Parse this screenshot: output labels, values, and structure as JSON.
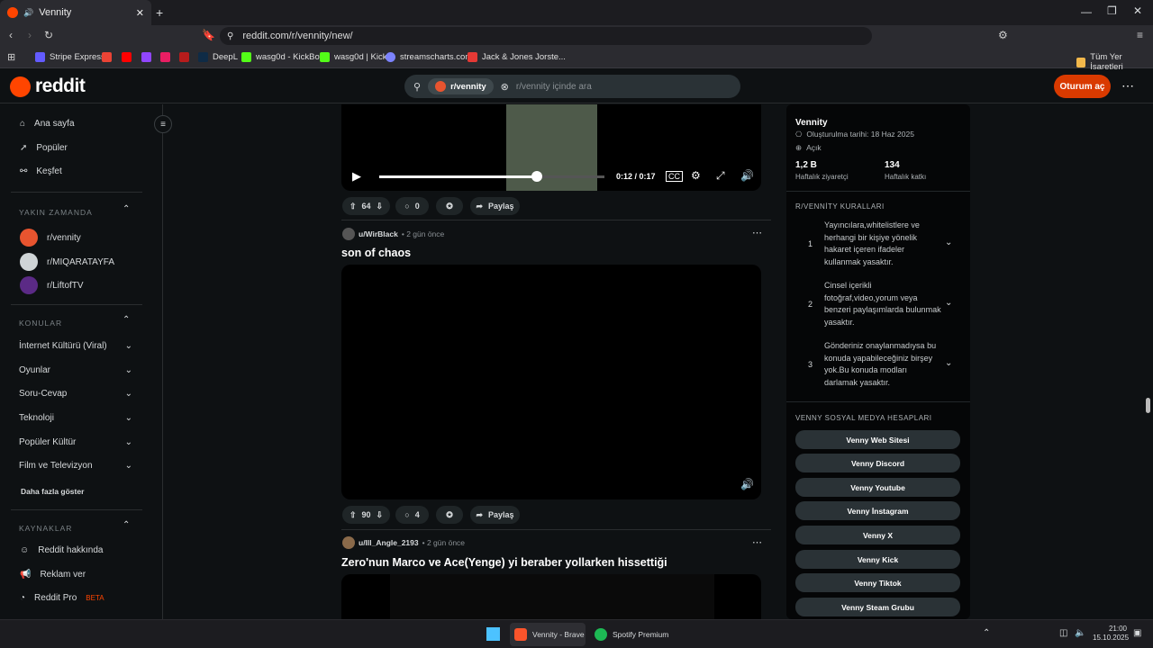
{
  "browser": {
    "tab_title": "Vennity",
    "url": "reddit.com/r/vennity/new/",
    "bookmarks": [
      "Stripe Express",
      "DeepL",
      "wasg0d - KickBot",
      "wasg0d | Kick",
      "streamscharts.com",
      "Jack & Jones Jorste..."
    ],
    "all_bookmarks": "Tüm Yer İşaretleri"
  },
  "header": {
    "logo": "reddit",
    "search_chip": "r/vennity",
    "search_placeholder": "r/vennity içinde ara",
    "login": "Oturum aç"
  },
  "sidebar": {
    "nav": [
      "Ana sayfa",
      "Popüler",
      "Keşfet"
    ],
    "recent_title": "YAKIN ZAMANDA",
    "recent": [
      "r/vennity",
      "r/MIQARATAYFA",
      "r/LiftofTV"
    ],
    "topics_title": "KONULAR",
    "topics": [
      "İnternet Kültürü (Viral)",
      "Oyunlar",
      "Soru-Cevap",
      "Teknoloji",
      "Popüler Kültür",
      "Film ve Televizyon"
    ],
    "more": "Daha fazla göster",
    "resources_title": "KAYNAKLAR",
    "resources": [
      "Reddit hakkında",
      "Reklam ver",
      "Reddit Pro"
    ],
    "beta": "BETA"
  },
  "feed": {
    "video1": {
      "time": "0:12 / 0:17",
      "progress": 0.7,
      "votes": "64",
      "comments": "0",
      "share": "Paylaş"
    },
    "post2": {
      "user": "u/WirBlack",
      "age": "• 2 gün önce",
      "title": "son of chaos",
      "votes": "90",
      "comments": "4",
      "share": "Paylaş"
    },
    "post3": {
      "user": "u/Ill_Angle_2193",
      "age": "• 2 gün önce",
      "title": "Zero'nun Marco ve Ace(Yenge) yi beraber yollarken hissettiği"
    }
  },
  "community": {
    "name": "Vennity",
    "created": "Oluşturulma tarihi: 18 Haz 2025",
    "status": "Açık",
    "visitors": "1,2 B",
    "visitors_label": "Haftalık ziyaretçi",
    "contrib": "134",
    "contrib_label": "Haftalık katkı",
    "rules_title": "R/VENNİTY KURALLARI",
    "rules": [
      {
        "n": "1",
        "text": "Yayıncılara,whitelistlere ve herhangi bir kişiye yönelik hakaret içeren ifadeler kullanmak yasaktır."
      },
      {
        "n": "2",
        "text": "Cinsel içerikli fotoğraf,video,yorum veya benzeri paylaşımlarda bulunmak yasaktır."
      },
      {
        "n": "3",
        "text": "Gönderiniz onaylanmadıysa bu konuda yapabileceğiniz birşey yok.Bu konuda modları darlamak yasaktır."
      }
    ],
    "social_title": "VENNY SOSYAL MEDYA HESAPLARI",
    "social": [
      "Venny Web Sitesi",
      "Venny Discord",
      "Venny Youtube",
      "Venny İnstagram",
      "Venny X",
      "Venny Kick",
      "Venny Tiktok",
      "Venny Steam Grubu"
    ]
  },
  "taskbar": {
    "app1": "Vennity - Brave",
    "app2": "Spotify Premium",
    "time": "21:00",
    "date": "15.10.2025"
  }
}
